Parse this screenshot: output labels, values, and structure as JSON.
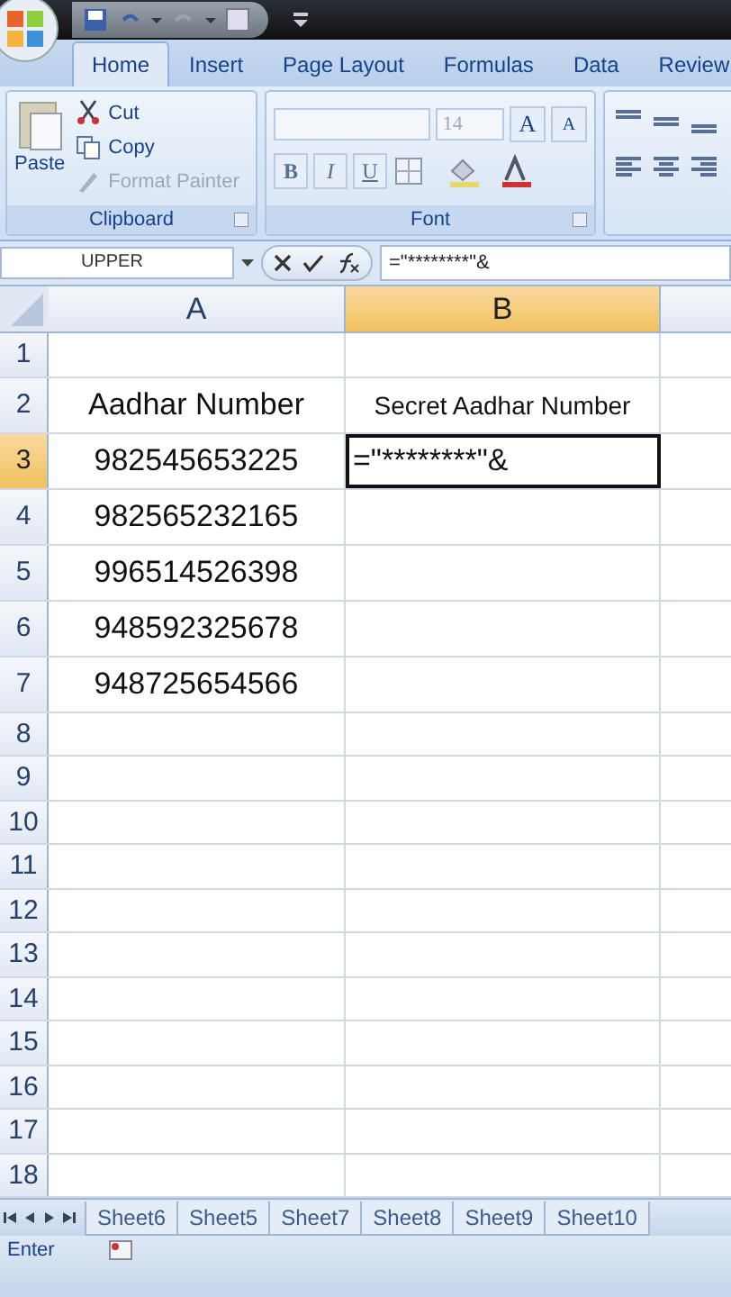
{
  "tabs": [
    {
      "label": "Home",
      "selected": true
    },
    {
      "label": "Insert",
      "selected": false
    },
    {
      "label": "Page Layout",
      "selected": false
    },
    {
      "label": "Formulas",
      "selected": false
    },
    {
      "label": "Data",
      "selected": false
    },
    {
      "label": "Review",
      "selected": false
    }
  ],
  "clipboard": {
    "paste": "Paste",
    "group": "Clipboard",
    "items": [
      {
        "label": "Cut",
        "disabled": false
      },
      {
        "label": "Copy",
        "disabled": false
      },
      {
        "label": "Format Painter",
        "disabled": true
      }
    ]
  },
  "font": {
    "size": "14",
    "grow": "A",
    "shrink": "A",
    "styles": [
      "B",
      "I",
      "U"
    ],
    "group": "Font"
  },
  "name_box": "UPPER",
  "formula": "=\"********\"&",
  "columns": [
    {
      "label": "A",
      "selected": false
    },
    {
      "label": "B",
      "selected": true
    }
  ],
  "rows": [
    {
      "number": "1",
      "selected": false,
      "cells": []
    },
    {
      "number": "2",
      "selected": false,
      "cells": [
        "Aadhar Number",
        "Secret Aadhar Number"
      ]
    },
    {
      "number": "3",
      "selected": true,
      "cells": [
        "982545653225",
        "=\"********\"&"
      ]
    },
    {
      "number": "4",
      "selected": false,
      "cells": [
        "982565232165"
      ]
    },
    {
      "number": "5",
      "selected": false,
      "cells": [
        "996514526398"
      ]
    },
    {
      "number": "6",
      "selected": false,
      "cells": [
        "948592325678"
      ]
    },
    {
      "number": "7",
      "selected": false,
      "cells": [
        "948725654566"
      ]
    },
    {
      "number": "8",
      "selected": false,
      "cells": []
    },
    {
      "number": "9",
      "selected": false,
      "cells": []
    },
    {
      "number": "10",
      "selected": false,
      "cells": []
    },
    {
      "number": "11",
      "selected": false,
      "cells": []
    },
    {
      "number": "12",
      "selected": false,
      "cells": []
    },
    {
      "number": "13",
      "selected": false,
      "cells": []
    },
    {
      "number": "14",
      "selected": false,
      "cells": []
    },
    {
      "number": "15",
      "selected": false,
      "cells": []
    },
    {
      "number": "16",
      "selected": false,
      "cells": []
    },
    {
      "number": "17",
      "selected": false,
      "cells": []
    },
    {
      "number": "18",
      "selected": false,
      "cells": []
    }
  ],
  "sheets": [
    {
      "label": "Sheet6",
      "selected": false
    },
    {
      "label": "Sheet5",
      "selected": false
    },
    {
      "label": "Sheet7",
      "selected": false
    },
    {
      "label": "Sheet8",
      "selected": false
    },
    {
      "label": "Sheet9",
      "selected": false
    },
    {
      "label": "Sheet10",
      "selected": false
    }
  ],
  "status": "Enter"
}
